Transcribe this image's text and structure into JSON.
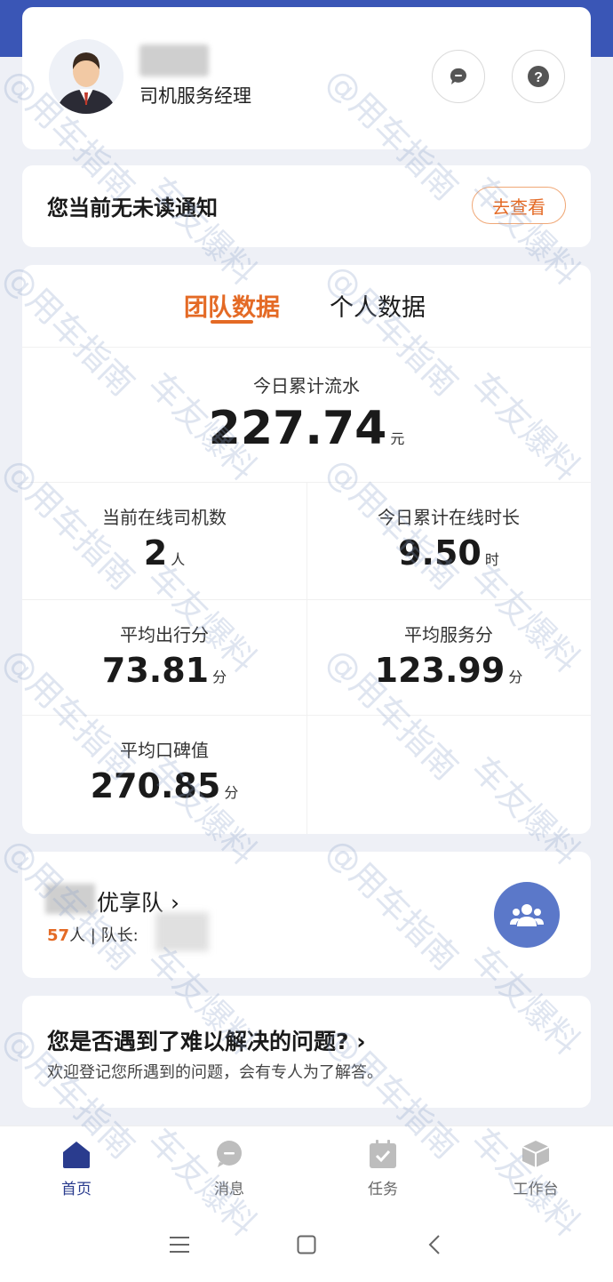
{
  "profile": {
    "role": "司机服务经理"
  },
  "notice": {
    "text": "您当前无未读通知",
    "view_label": "去查看"
  },
  "tabs": {
    "team": "团队数据",
    "personal": "个人数据"
  },
  "today_revenue": {
    "label": "今日累计流水",
    "value": "227.74",
    "unit": "元"
  },
  "stats": [
    {
      "label": "当前在线司机数",
      "value": "2",
      "unit": "人"
    },
    {
      "label": "今日累计在线时长",
      "value": "9.50",
      "unit": "时"
    },
    {
      "label": "平均出行分",
      "value": "73.81",
      "unit": "分"
    },
    {
      "label": "平均服务分",
      "value": "123.99",
      "unit": "分"
    },
    {
      "label": "平均口碑值",
      "value": "270.85",
      "unit": "分"
    }
  ],
  "team": {
    "name": "优享队",
    "chevron": "›",
    "count": "57",
    "meta": "人 | 队长:"
  },
  "help": {
    "title": "您是否遇到了难以解决的问题?",
    "chevron": "›",
    "subtitle": "欢迎登记您所遇到的问题，会有专人为了解答。"
  },
  "nav": [
    {
      "label": "首页",
      "icon": "home-icon",
      "active": true
    },
    {
      "label": "消息",
      "icon": "message-icon",
      "active": false
    },
    {
      "label": "任务",
      "icon": "task-icon",
      "active": false
    },
    {
      "label": "工作台",
      "icon": "workbench-icon",
      "active": false
    }
  ],
  "watermark": {
    "line1": "@用车指南",
    "line2": "车友爆料",
    "id": "3325144"
  },
  "colors": {
    "accent": "#e46a25",
    "brand": "#3a56b6",
    "fab": "#5b78c9"
  }
}
